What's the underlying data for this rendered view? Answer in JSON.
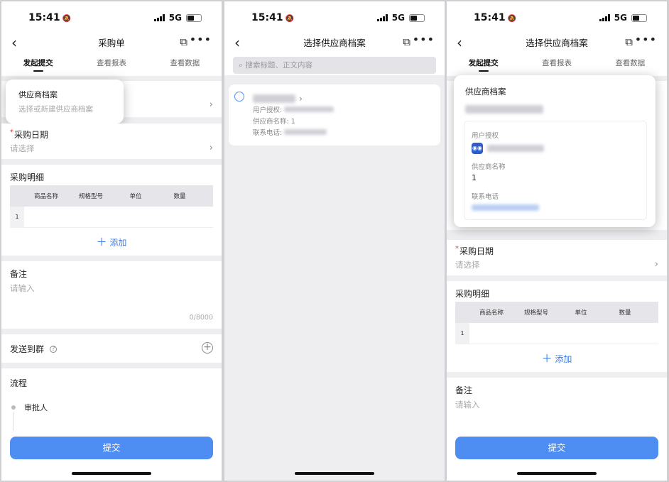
{
  "status": {
    "time": "15:41",
    "network": "5G"
  },
  "phone1": {
    "title": "采购单",
    "tabs": [
      "发起提交",
      "查看报表",
      "查看数据"
    ],
    "supplier": {
      "label": "供应商档案",
      "placeholder": "选择或新建供应商档案"
    },
    "date": {
      "label": "采购日期",
      "placeholder": "请选择"
    },
    "detail": {
      "label": "采购明细",
      "columns": [
        "商品名称",
        "规格型号",
        "单位",
        "数量"
      ],
      "row_index": "1",
      "add": "添加"
    },
    "remark": {
      "label": "备注",
      "placeholder": "请输入",
      "counter": "0/8000"
    },
    "send": {
      "label": "发送到群"
    },
    "flow": {
      "label": "流程",
      "approver": "审批人"
    },
    "submit": "提交"
  },
  "phone2": {
    "title": "选择供应商档案",
    "search_placeholder": "搜索标题、正文内容",
    "item": {
      "auth_label": "用户授权:",
      "name_label": "供应商名称:",
      "name_value": "1",
      "phone_label": "联系电话:"
    }
  },
  "phone3": {
    "title": "选择供应商档案",
    "tabs": [
      "发起提交",
      "查看报表",
      "查看数据"
    ],
    "popup": {
      "label": "供应商档案",
      "auth_label": "用户授权",
      "name_label": "供应商名称",
      "name_value": "1",
      "phone_label": "联系电话"
    },
    "date": {
      "label": "采购日期",
      "placeholder": "请选择"
    },
    "detail": {
      "label": "采购明细",
      "columns": [
        "商品名称",
        "规格型号",
        "单位",
        "数量"
      ],
      "row_index": "1",
      "add": "添加"
    },
    "remark": {
      "label": "备注",
      "placeholder": "请输入"
    },
    "submit": "提交"
  },
  "colors": {
    "accent": "#4e8ef2",
    "link": "#3b7de9",
    "required": "#e53935"
  }
}
